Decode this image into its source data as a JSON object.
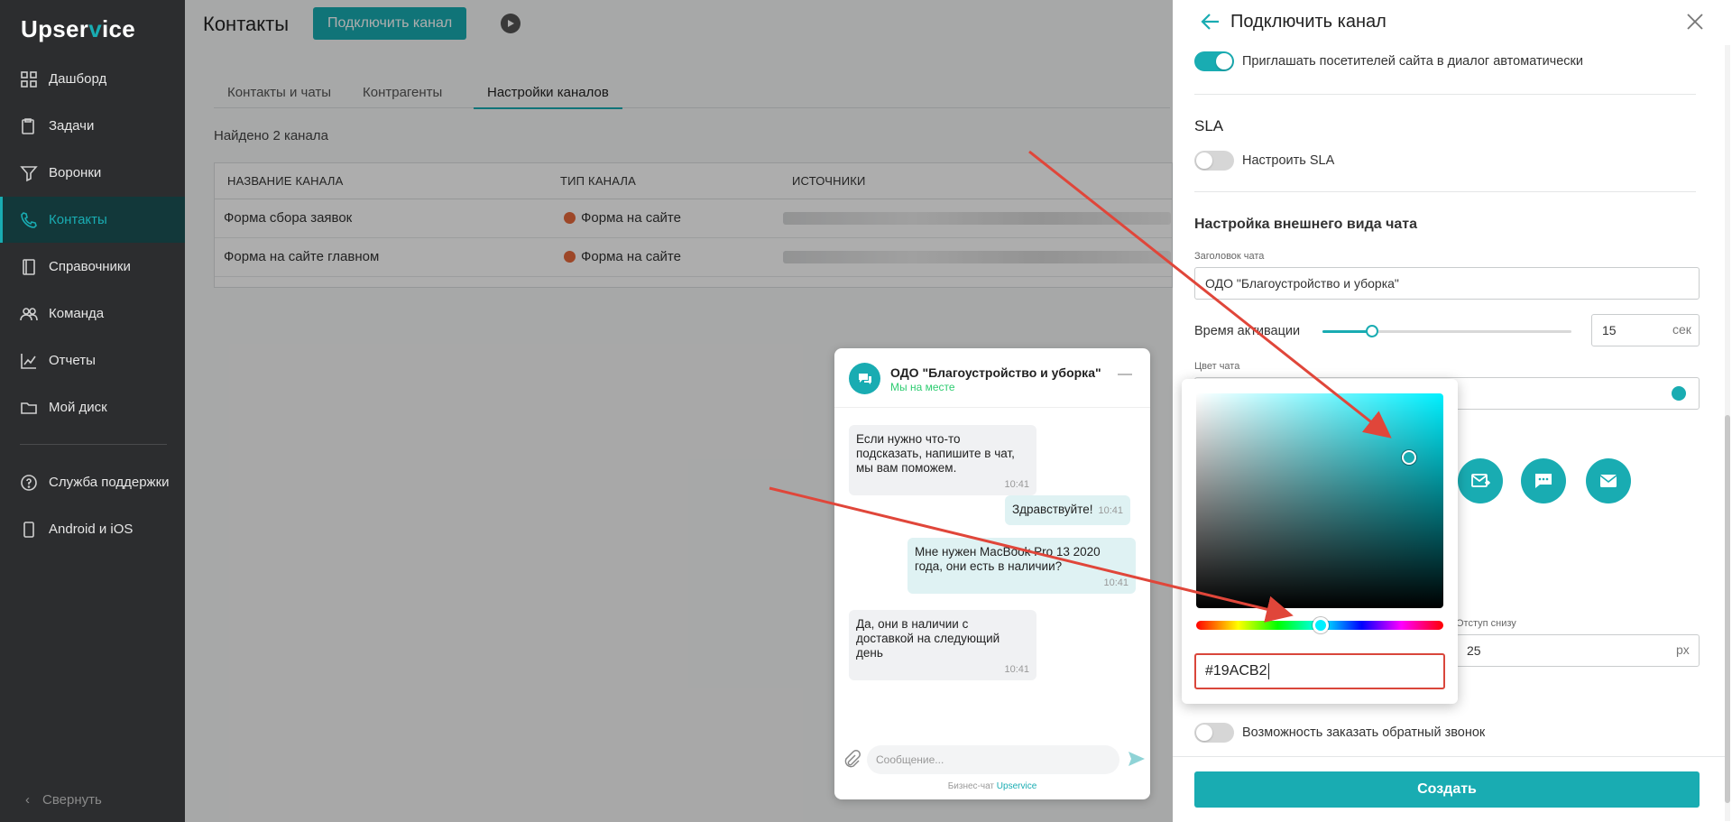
{
  "app": {
    "logo_prefix": "Upser",
    "logo_accent": "v",
    "logo_suffix": "ice"
  },
  "sidebar": {
    "items": [
      {
        "label": "Дашборд",
        "icon": "dashboard-icon"
      },
      {
        "label": "Задачи",
        "icon": "tasks-icon"
      },
      {
        "label": "Воронки",
        "icon": "funnel-icon"
      },
      {
        "label": "Контакты",
        "icon": "contacts-icon",
        "active": true
      },
      {
        "label": "Справочники",
        "icon": "book-icon"
      },
      {
        "label": "Команда",
        "icon": "team-icon"
      },
      {
        "label": "Отчеты",
        "icon": "chart-icon"
      },
      {
        "label": "Мой диск",
        "icon": "folder-icon"
      }
    ],
    "bottom_items": [
      {
        "label": "Служба поддержки",
        "icon": "help-icon"
      },
      {
        "label": "Android и iOS",
        "icon": "phone-icon"
      }
    ],
    "collapse_label": "Свернуть"
  },
  "main": {
    "title": "Контакты",
    "connect_button": "Подключить канал",
    "tabs": [
      "Контакты и чаты",
      "Контрагенты",
      "Настройки каналов"
    ],
    "active_tab": "Настройки каналов",
    "found_text": "Найдено 2 канала",
    "table": {
      "columns": [
        "НАЗВАНИЕ КАНАЛА",
        "ТИП КАНАЛА",
        "ИСТОЧНИКИ"
      ],
      "rows": [
        {
          "name": "Форма сбора заявок",
          "type": "Форма на сайте"
        },
        {
          "name": "Форма на сайте главном",
          "type": "Форма на сайте"
        }
      ]
    }
  },
  "chat": {
    "title": "ОДО \"Благоустройство и уборка\"",
    "status": "Мы на месте",
    "messages": [
      {
        "dir": "in",
        "text": "Если нужно что-то подсказать, напишите в чат, мы вам поможем.",
        "time": "10:41"
      },
      {
        "dir": "out",
        "text": "Здравствуйте!",
        "time": "10:41"
      },
      {
        "dir": "out",
        "text": "Мне нужен MacBook Pro 13 2020 года, они есть в наличии?",
        "time": "10:41"
      },
      {
        "dir": "in",
        "text": "Да, они в наличии с доставкой на следующий день",
        "time": "10:41"
      }
    ],
    "input_placeholder": "Сообщение...",
    "footer_prefix": "Бизнес-чат ",
    "footer_brand": "Upservice"
  },
  "panel": {
    "title": "Подключить канал",
    "invite_toggle_label": "Приглашать посетителей сайта в диалог автоматически",
    "invite_toggle_on": true,
    "sla_heading": "SLA",
    "sla_toggle_label": "Настроить SLA",
    "sla_toggle_on": false,
    "appearance_heading": "Настройка внешнего вида чата",
    "chat_title_label": "Заголовок чата",
    "chat_title_value": "ОДО \"Благоустройство и уборка\"",
    "activation_label": "Время активации",
    "activation_value": "15",
    "activation_unit": "сек",
    "activation_slider_fraction": 0.2,
    "color_label": "Цвет чата",
    "chat_color": "#19ACB2",
    "bottom_offset_label": "Отступ снизу",
    "bottom_offset_value": "25",
    "bottom_offset_unit": "px",
    "callback_toggle_label": "Возможность заказать обратный звонок",
    "callback_toggle_on": false,
    "create_button": "Создать",
    "icon_options": [
      "chat-mail-icon",
      "chat-bubble-icon",
      "envelope-icon"
    ]
  },
  "color_picker": {
    "hex_value": "#19ACB2",
    "hue_color": "#00f0ff",
    "saturation": 0.86,
    "brightness": 0.7,
    "hue_fraction": 0.505
  },
  "colors": {
    "accent": "#19acb2",
    "annotation": "#e0463a",
    "sidebar_bg": "#2c2d2f"
  }
}
